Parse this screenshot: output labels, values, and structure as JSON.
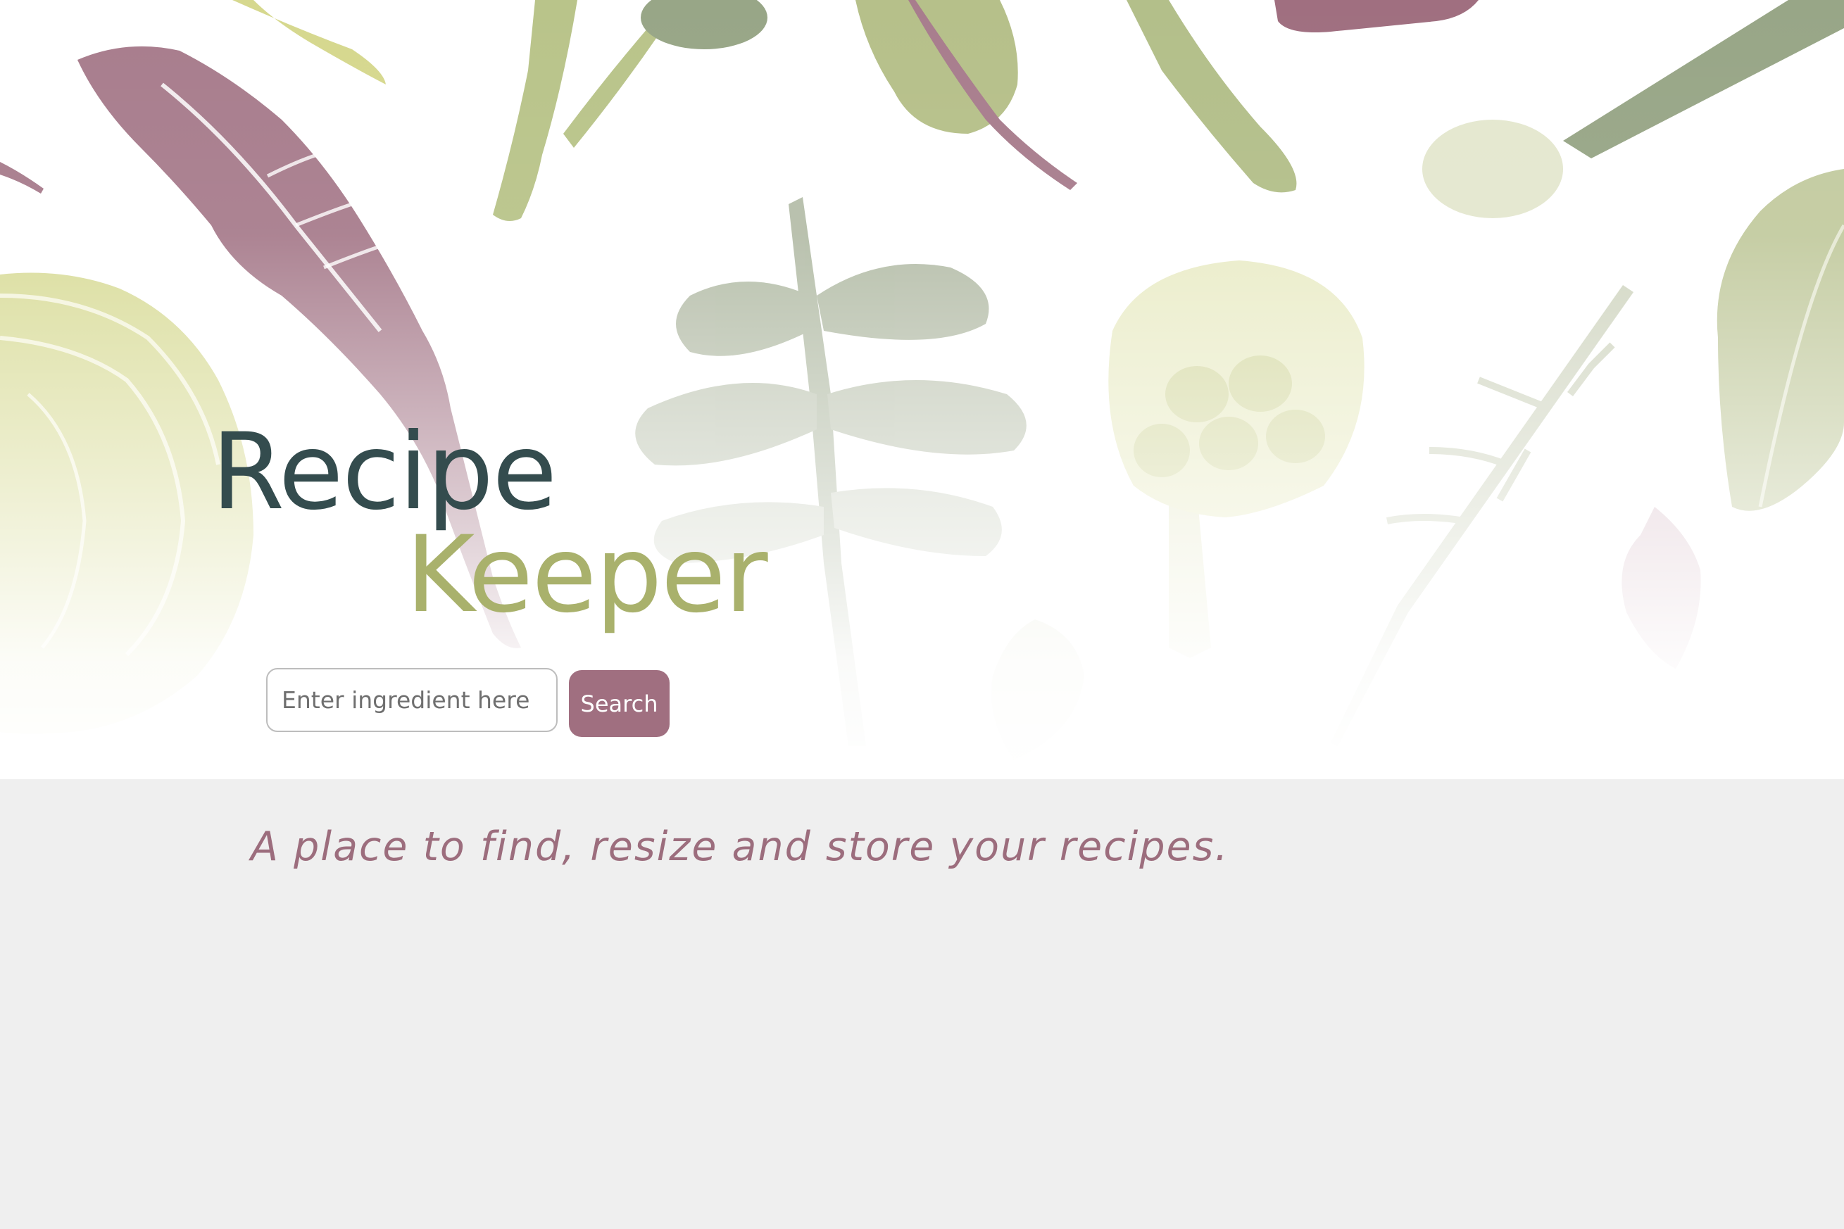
{
  "hero": {
    "logo": {
      "word1": "Recipe",
      "word2": "Keeper"
    },
    "search": {
      "placeholder": "Enter ingredient here",
      "value": "",
      "button_label": "Search"
    },
    "illustration_icons": [
      "radicchio-leaf-icon",
      "cabbage-icon",
      "carrot-tops-icon",
      "artichoke-icon",
      "rosemary-sprig-icon",
      "lettuce-leaf-icon",
      "asparagus-icon",
      "chard-leaf-icon",
      "leek-icon",
      "basil-leaf-icon"
    ]
  },
  "main": {
    "tagline": "A place to find, resize and store your recipes."
  },
  "colors": {
    "page_background": "#efefef",
    "hero_background": "#ffffff",
    "logo_dark": "#344c4e",
    "logo_green": "#a9b16c",
    "accent_mauve": "#a06f80",
    "tagline": "#9c6d7d",
    "leaf_green": "#a9b57a",
    "leaf_sage": "#9eae8f",
    "leaf_yellow": "#d8da9c",
    "leaf_pale": "#e7e9c8"
  }
}
